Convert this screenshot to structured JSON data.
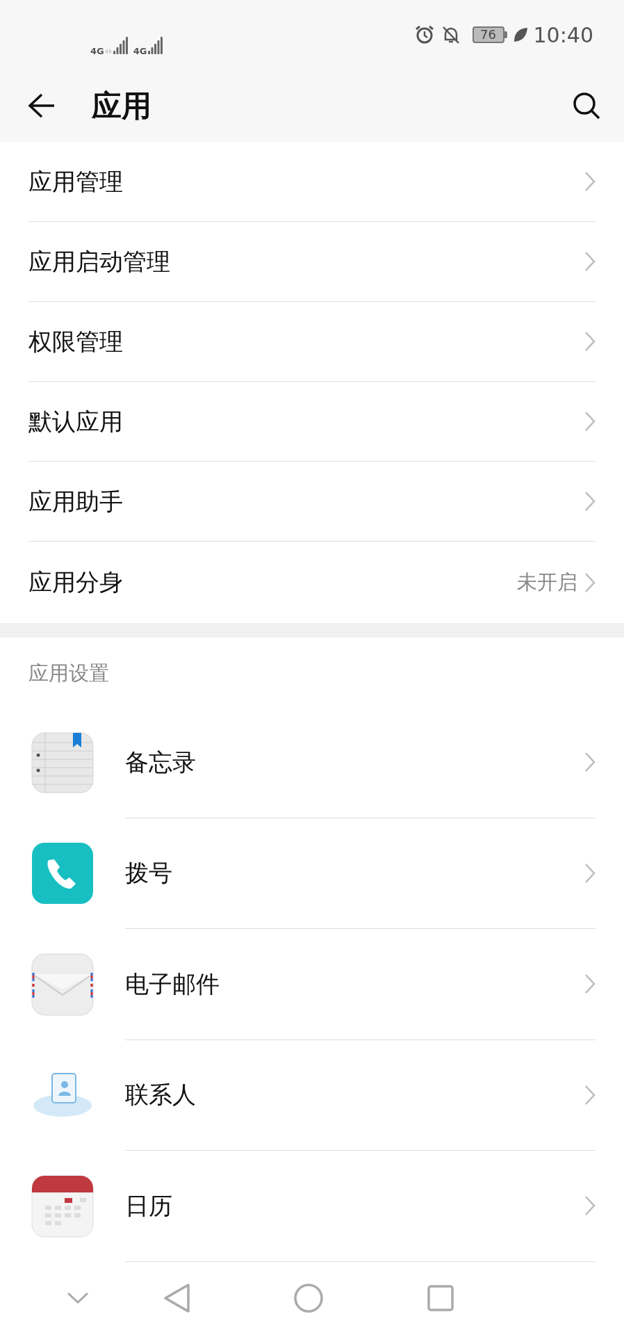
{
  "status_bar": {
    "signals": [
      {
        "label": "4G"
      },
      {
        "label": "4G"
      }
    ],
    "battery": "76",
    "time": "10:40"
  },
  "header": {
    "title": "应用"
  },
  "menu_items": [
    {
      "label": "应用管理"
    },
    {
      "label": "应用启动管理"
    },
    {
      "label": "权限管理"
    },
    {
      "label": "默认应用"
    },
    {
      "label": "应用助手"
    },
    {
      "label": "应用分身",
      "value": "未开启"
    }
  ],
  "app_settings": {
    "title": "应用设置",
    "apps": [
      {
        "name": "备忘录",
        "kind": "notes"
      },
      {
        "name": "拨号",
        "kind": "phone"
      },
      {
        "name": "电子邮件",
        "kind": "email"
      },
      {
        "name": "联系人",
        "kind": "contacts"
      },
      {
        "name": "日历",
        "kind": "calendar"
      }
    ]
  }
}
